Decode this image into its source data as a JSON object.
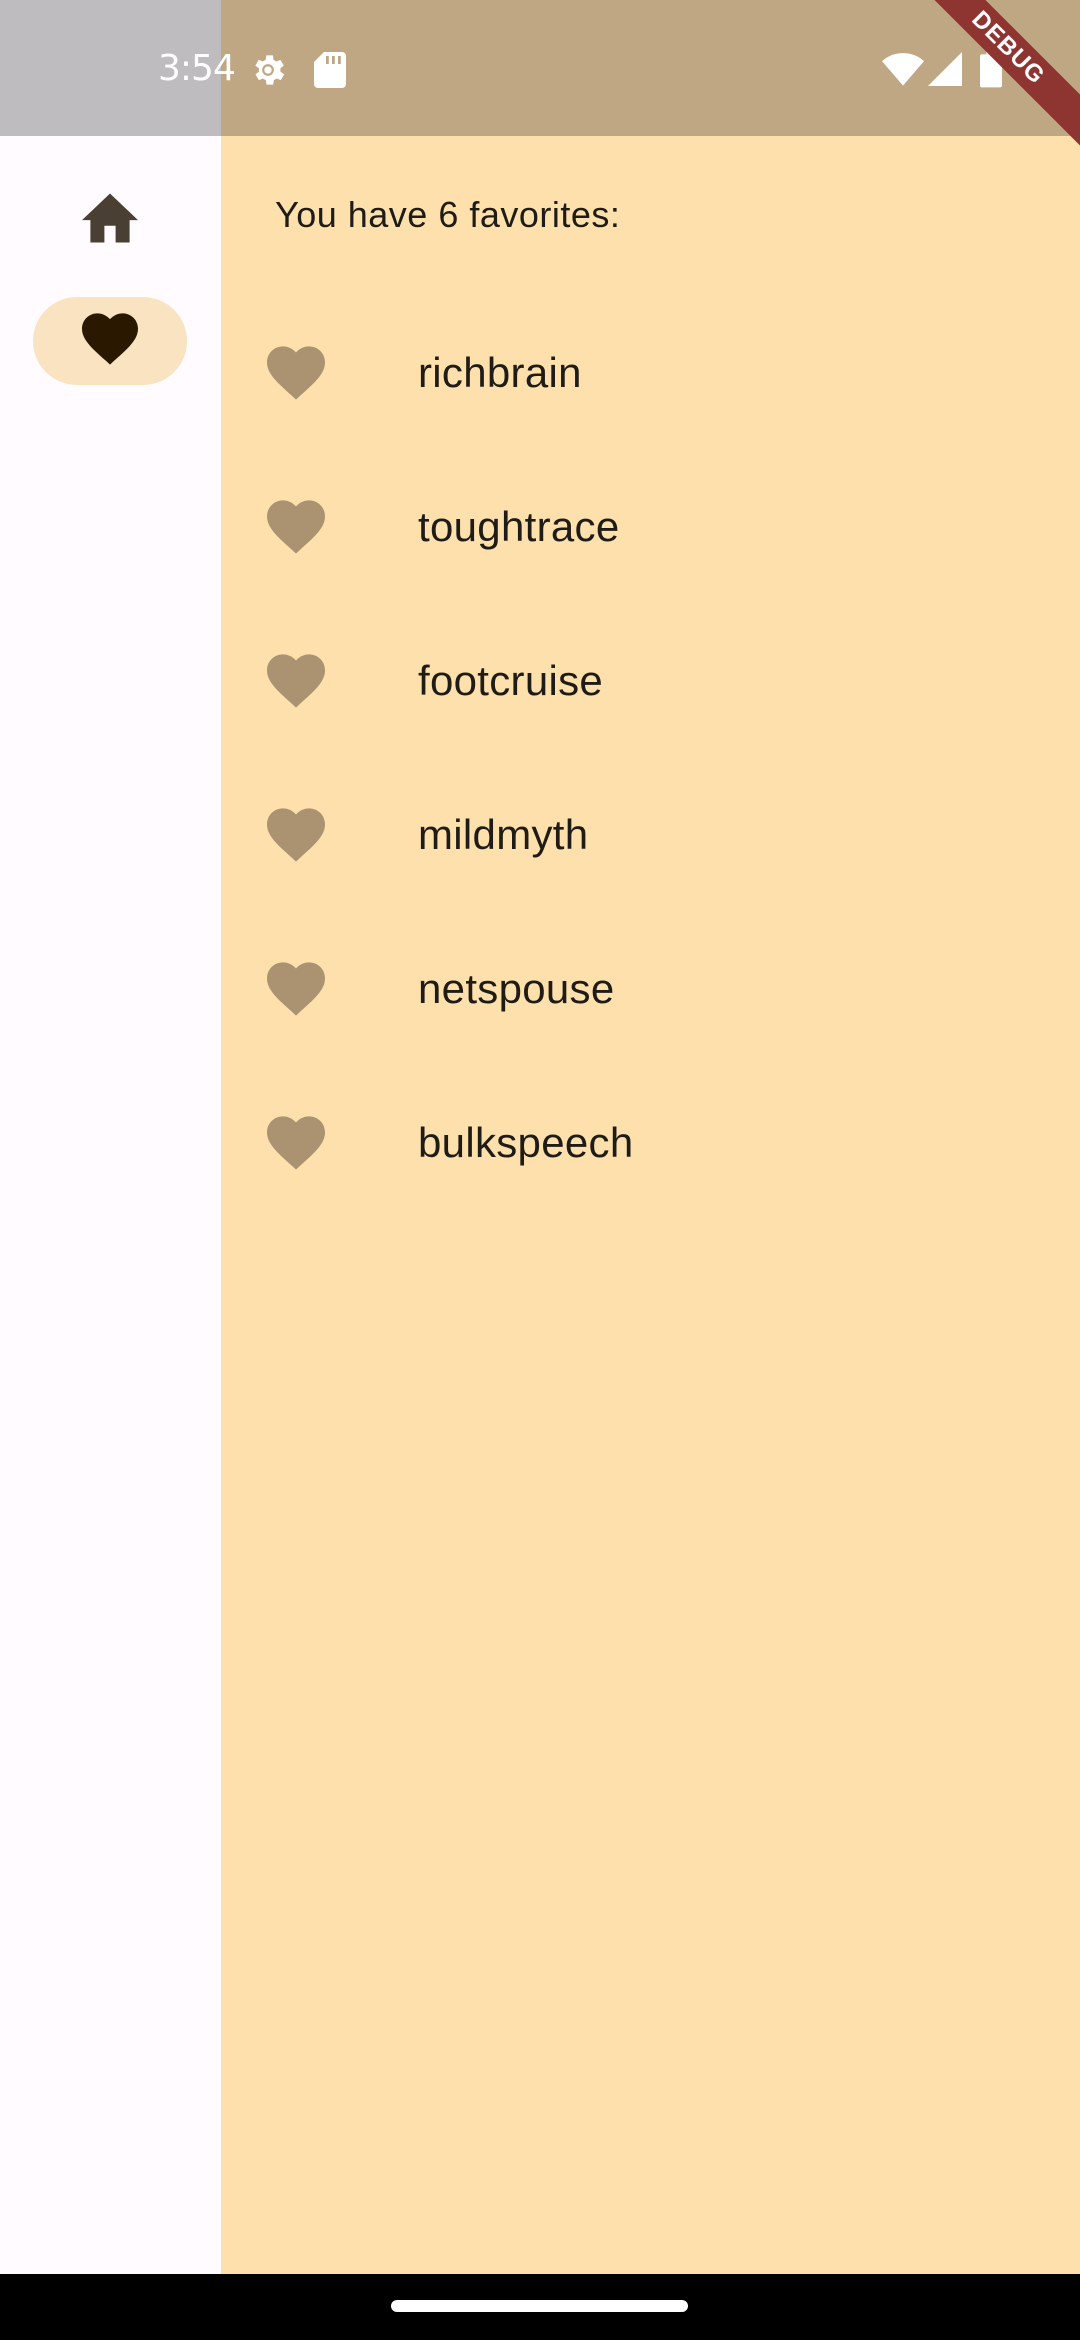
{
  "status_bar": {
    "time": "3:54",
    "icons": [
      "settings-icon",
      "sd-card-icon",
      "wifi-icon",
      "signal-icon",
      "battery-icon"
    ]
  },
  "debug_banner": "DEBUG",
  "nav_rail": {
    "items": [
      {
        "icon": "home-icon",
        "selected": false
      },
      {
        "icon": "heart-icon",
        "selected": true
      }
    ]
  },
  "favorites": {
    "header": "You have 6 favorites:",
    "items": [
      {
        "name": "richbrain"
      },
      {
        "name": "toughtrace"
      },
      {
        "name": "footcruise"
      },
      {
        "name": "mildmyth"
      },
      {
        "name": "netspouse"
      },
      {
        "name": "bulkspeech"
      }
    ]
  },
  "colors": {
    "content_bg": "#fde0ac",
    "rail_bg": "#fffbff",
    "selected_pill": "#f9e3c0",
    "heart": "#ab9372",
    "text": "#1f1b16",
    "debug": "#8e3532"
  }
}
